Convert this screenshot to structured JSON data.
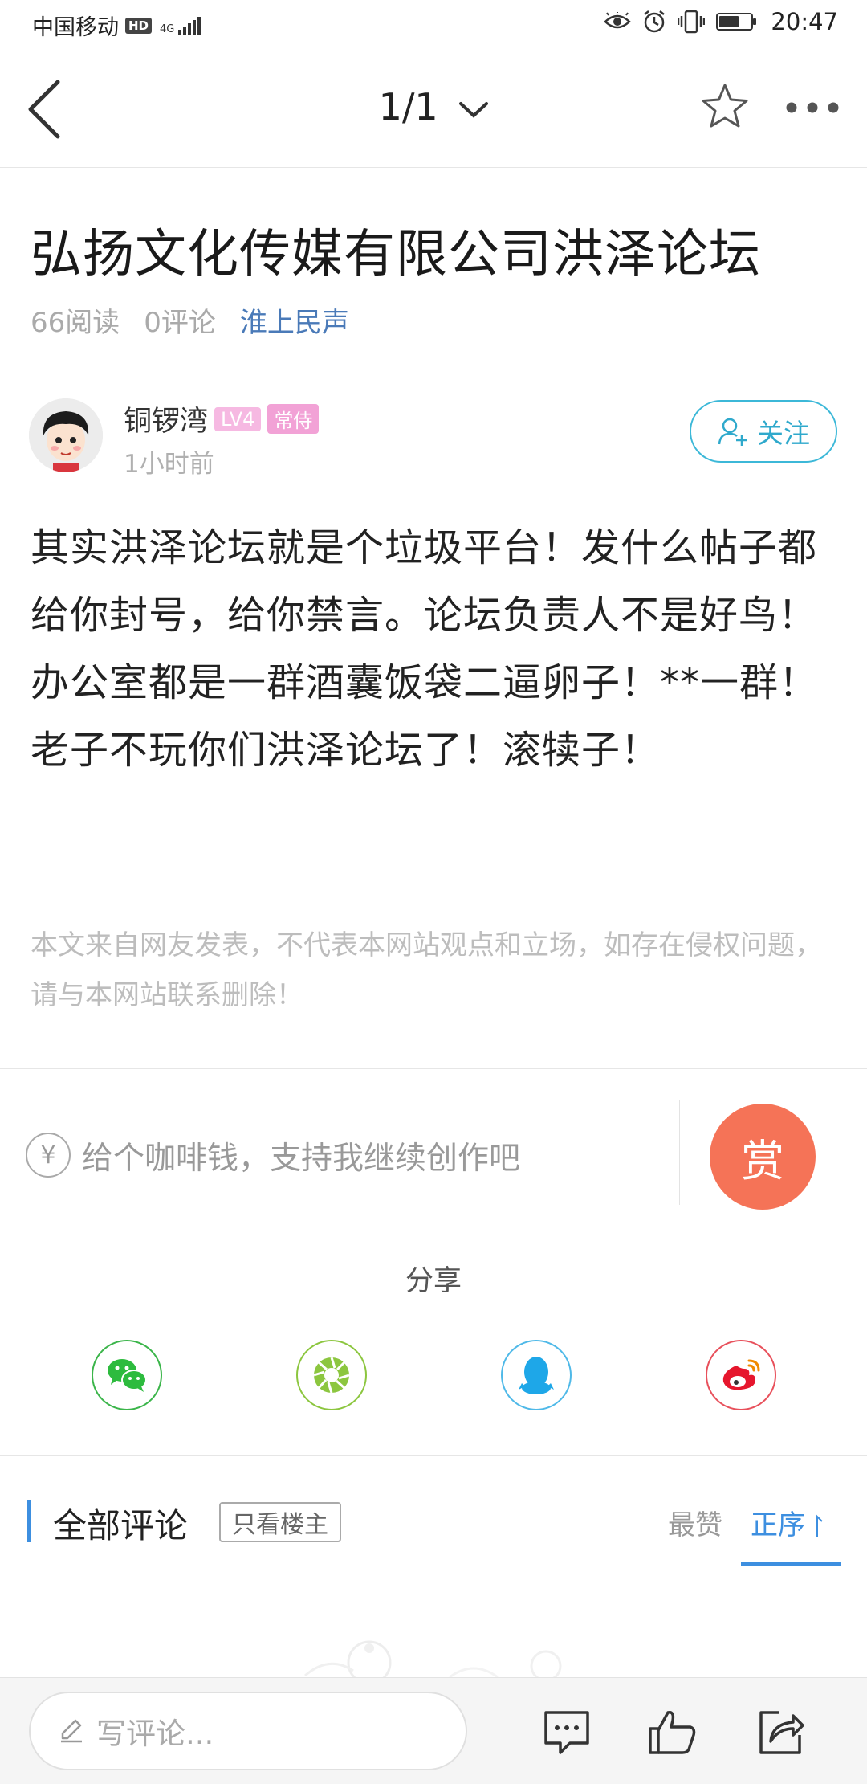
{
  "status_bar": {
    "carrier": "中国移动",
    "hd": "HD",
    "network": "4G",
    "time": "20:47"
  },
  "nav": {
    "pager": "1/1"
  },
  "article": {
    "title": "弘扬文化传媒有限公司洪泽论坛",
    "reads": "66阅读",
    "comments": "0评论",
    "source": "淮上民声",
    "author": {
      "name": "铜锣湾",
      "level": "LV4",
      "role": "常侍",
      "time": "1小时前"
    },
    "follow_label": "关注",
    "body": "其实洪泽论坛就是个垃圾平台！发什么帖子都给你封号，给你禁言。论坛负责人不是好鸟！办公室都是一群酒囊饭袋二逼卵子！**一群！老子不玩你们洪泽论坛了！滚犊子！",
    "disclaimer": "本文来自网友发表，不代表本网站观点和立场，如存在侵权问题，请与本网站联系删除！"
  },
  "tip": {
    "icon_glyph": "¥",
    "text": "给个咖啡钱，支持我继续创作吧",
    "button": "赏"
  },
  "share": {
    "label": "分享",
    "targets": [
      "wechat-icon",
      "moments-icon",
      "qq-icon",
      "weibo-icon"
    ]
  },
  "comments": {
    "title": "全部评论",
    "filter": "只看楼主",
    "sort_top": "最赞",
    "sort_order": "正序"
  },
  "bottom_bar": {
    "placeholder": "写评论..."
  },
  "colors": {
    "accent_blue": "#3d8fe0",
    "follow_cyan": "#2fa9cc",
    "reward_orange": "#f57357",
    "source_blue": "#4a7ab8"
  }
}
